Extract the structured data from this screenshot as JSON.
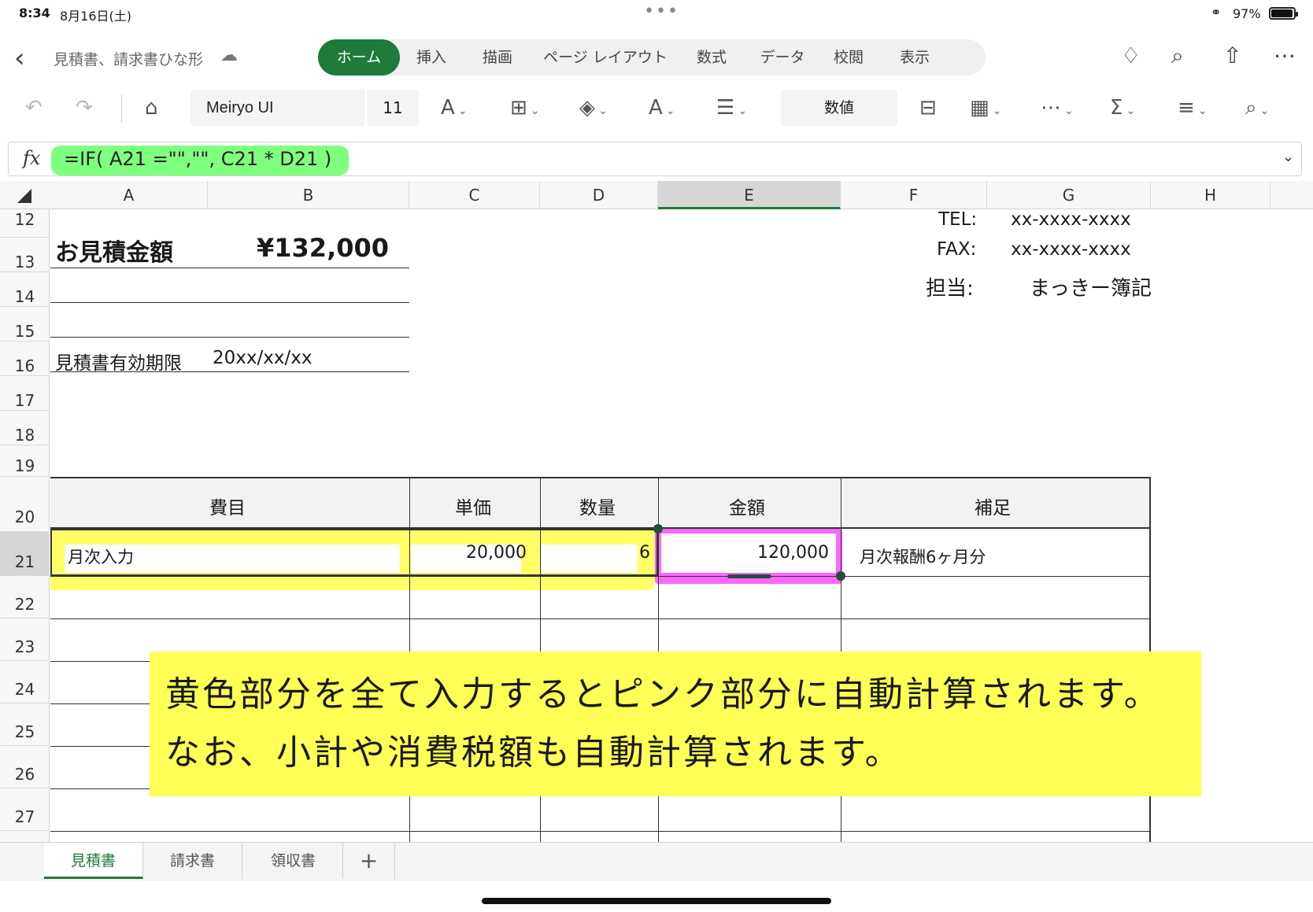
{
  "status_bar": {
    "time": "8:34",
    "date": "8月16日(土)",
    "battery": "97%",
    "battery_level": 0.97
  },
  "title_bar": {
    "doc_title": "見積書、請求書ひな形",
    "tabs": [
      "ホーム",
      "挿入",
      "描画",
      "ページ レイアウト",
      "数式",
      "データ",
      "校閲",
      "表示"
    ],
    "active_tab": "ホーム"
  },
  "toolbar": {
    "font": "Meiryo UI",
    "size": "11",
    "number_format": "数値"
  },
  "formula_bar": {
    "fx": "fx",
    "formula": "=IF( A21 =\"\",\"\", C21 * D21 )"
  },
  "grid": {
    "columns": [
      "A",
      "B",
      "C",
      "D",
      "E",
      "F",
      "G",
      "H"
    ],
    "selected_column": "E",
    "rows": [
      "12",
      "13",
      "14",
      "15",
      "16",
      "17",
      "18",
      "19",
      "20",
      "21",
      "22",
      "23",
      "24",
      "25",
      "26",
      "27"
    ],
    "selected_row": "21",
    "estimate_label": "お見積金額",
    "estimate_amount": "¥132,000",
    "validity_label": "見積書有効期限",
    "validity_date": "20xx/xx/xx",
    "tel_label": "TEL:",
    "tel_value": "xx-xxxx-xxxx",
    "fax_label": "FAX:",
    "fax_value": "xx-xxxx-xxxx",
    "contact_label": "担当:",
    "contact_value": "まっきー簿記",
    "table_headers": [
      "費目",
      "単価",
      "数量",
      "金額",
      "補足"
    ],
    "row21": {
      "item": "月次入力",
      "unit_price": "20,000",
      "qty": "6",
      "amount": "120,000",
      "note": "月次報酬6ヶ月分"
    }
  },
  "callout": {
    "line1": "黄色部分を全て入力するとピンク部分に自動計算されます。",
    "line2": "なお、小計や消費税額も自動計算されます。"
  },
  "sheets": [
    "見積書",
    "請求書",
    "領収書"
  ],
  "active_sheet": "見積書",
  "add_sheet": "+",
  "colors": {
    "accent": "#1e7b3a",
    "yellow_highlight": "#ffff55",
    "pink_highlight": "#ff66ff",
    "formula_highlight": "#7fff7f"
  }
}
